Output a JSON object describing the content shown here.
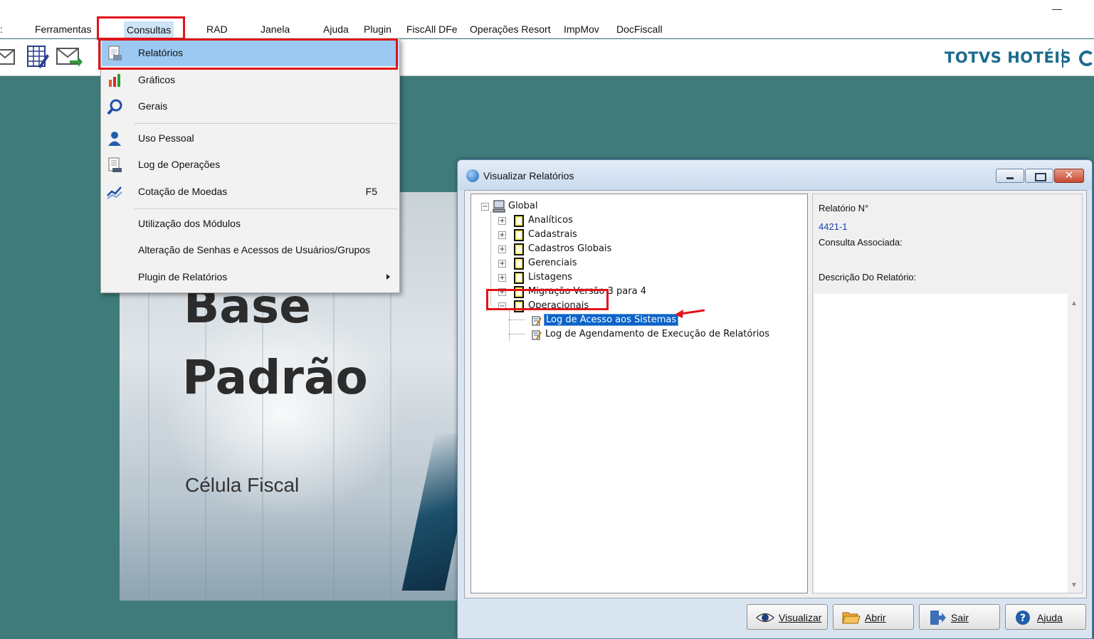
{
  "menubar": {
    "items": [
      "Ferramentas",
      "Consultas",
      "RAD",
      "Janela",
      "Ajuda",
      "Plugin",
      "FiscAll DFe",
      "Operações Resort",
      "ImpMov",
      "DocFiscall"
    ],
    "active": "Consultas"
  },
  "toolbar": {
    "icons": [
      "mail-icon",
      "spreadsheet-edit-icon",
      "mail-send-icon"
    ],
    "brand": "TOTVS HOTÉIS"
  },
  "splash": {
    "title_line1": "Base",
    "title_line2": "Padrão",
    "subtitle": "Célula Fiscal"
  },
  "dropdown": {
    "items": [
      {
        "label": "Relatórios",
        "icon": "report-icon",
        "highlighted": true
      },
      {
        "label": "Gráficos",
        "icon": "bar-chart-icon"
      },
      {
        "label": "Gerais",
        "icon": "magnifier-icon"
      },
      {
        "label": "Uso Pessoal",
        "icon": "user-icon"
      },
      {
        "label": "Log de Operações",
        "icon": "log-document-icon"
      },
      {
        "label": "Cotação de Moedas",
        "icon": "currency-chart-icon",
        "shortcut": "F5"
      },
      {
        "label": "Utilização dos Módulos"
      },
      {
        "label": "Alteração de Senhas e Acessos de Usuários/Grupos"
      },
      {
        "label": "Plugin de Relatórios",
        "submenu": true
      }
    ]
  },
  "dialog": {
    "title": "Visualizar Relatórios",
    "tree": {
      "root": "Global",
      "folders": [
        "Analíticos",
        "Cadastrais",
        "Cadastros Globais",
        "Gerenciais",
        "Listagens",
        "Migração Versão 3 para 4",
        "Operacionais"
      ],
      "expanded_folder": "Operacionais",
      "reports": [
        "Log de Acesso aos Sistemas",
        "Log de Agendamento de Execução de Relatórios"
      ],
      "selected_report": "Log de Acesso aos Sistemas"
    },
    "info": {
      "report_number_label": "Relatório N°",
      "report_number_value": "4421-1",
      "associated_query_label": "Consulta Associada:",
      "description_label": "Descrição Do Relatório:"
    },
    "buttons": {
      "view": "Visualizar",
      "open": "Abrir",
      "exit": "Sair",
      "help": "Ajuda"
    }
  },
  "colors": {
    "desktop": "#3f7b7b",
    "highlight": "#9cc9f1",
    "selection": "#0a63c9",
    "annotation_red": "#e0141a",
    "brand": "#1a6b8c"
  }
}
